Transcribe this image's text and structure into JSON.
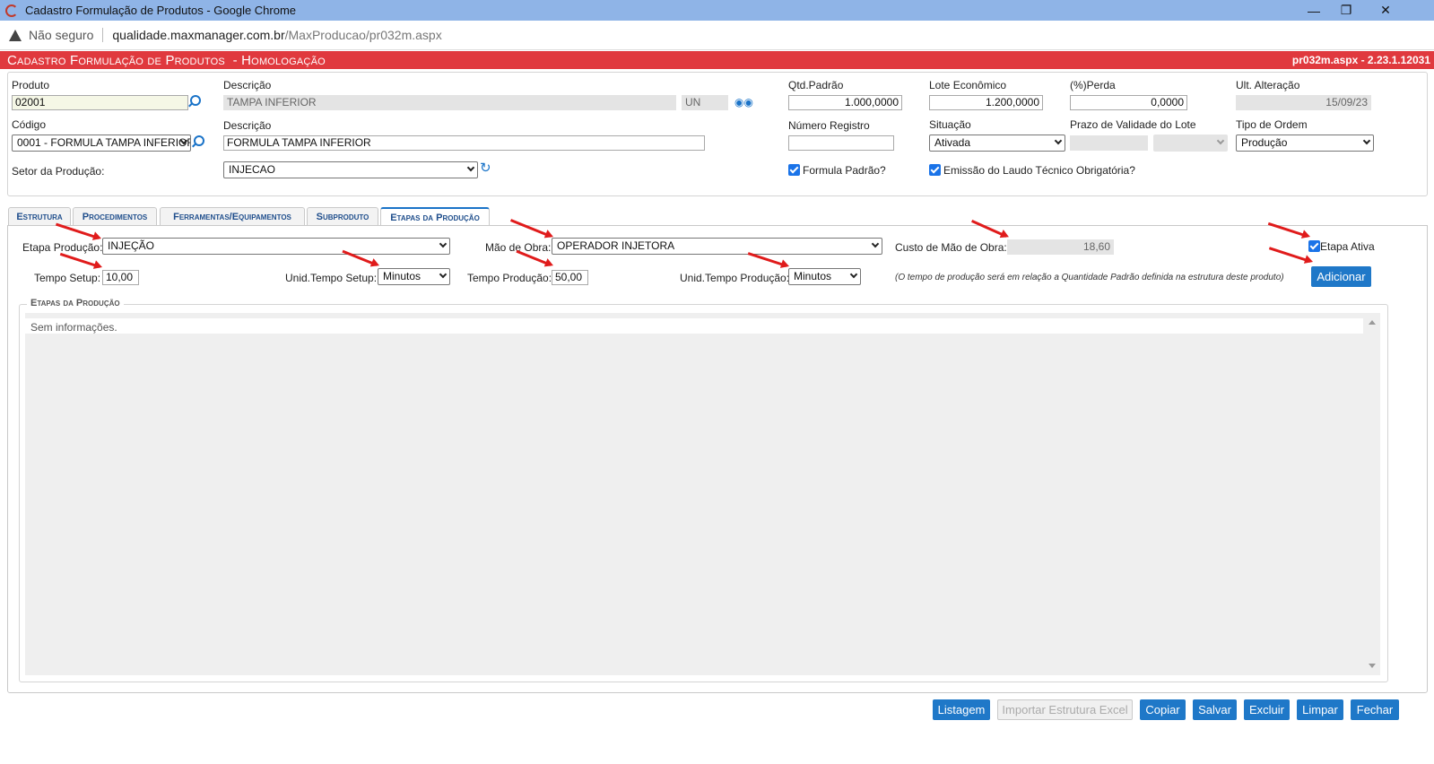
{
  "window": {
    "title": "Cadastro Formulação de Produtos - Google Chrome",
    "minimize": "—",
    "restore": "❐",
    "close": "✕"
  },
  "address": {
    "security": "Não seguro",
    "host": "qualidade.maxmanager.com.br",
    "path": "/MaxProducao/pr032m.aspx"
  },
  "header": {
    "title": "Cadastro Formulação de Produtos  - Homologação",
    "version": "pr032m.aspx - 2.23.1.12031"
  },
  "form": {
    "produto_label": "Produto",
    "produto_value": "02001",
    "descricao_label": "Descrição",
    "descricao_value": "TAMPA INFERIOR",
    "unidade_value": "UN",
    "qtd_padrao_label": "Qtd.Padrão",
    "qtd_padrao_value": "1.000,0000",
    "lote_economico_label": "Lote Econômico",
    "lote_economico_value": "1.200,0000",
    "perda_label": "(%)Perda",
    "perda_value": "0,0000",
    "ult_alteracao_label": "Ult. Alteração",
    "ult_alteracao_value": "15/09/23",
    "codigo_label": "Código",
    "codigo_value": "0001 - FORMULA TAMPA INFERIOR",
    "descricao2_label": "Descrição",
    "descricao2_value": "FORMULA TAMPA INFERIOR",
    "numero_registro_label": "Número Registro",
    "numero_registro_value": "",
    "situacao_label": "Situação",
    "situacao_value": "Ativada",
    "prazo_validade_label": "Prazo de Validade do Lote",
    "prazo_validade_value": "",
    "prazo_validade_unit": "",
    "tipo_ordem_label": "Tipo de Ordem",
    "tipo_ordem_value": "Produção",
    "setor_label": "Setor da Produção:",
    "setor_value": "INJECAO",
    "formula_padrao_label": "Formula Padrão?",
    "formula_padrao_checked": true,
    "emissao_laudo_label": "Emissão do Laudo Técnico Obrigatória?",
    "emissao_laudo_checked": true
  },
  "tabs": [
    {
      "label": "Estrutura",
      "active": false
    },
    {
      "label": "Procedimentos",
      "active": false
    },
    {
      "label": "Ferramentas/Equipamentos",
      "active": false
    },
    {
      "label": "Subproduto",
      "active": false
    },
    {
      "label": "Etapas da Produção",
      "active": true
    }
  ],
  "etapa": {
    "etapa_label": "Etapa Produção:",
    "etapa_value": "INJEÇÃO",
    "mao_obra_label": "Mão de Obra:",
    "mao_obra_value": "OPERADOR INJETORA",
    "custo_label": "Custo de Mão de Obra:",
    "custo_value": "18,60",
    "ativa_label": "Etapa Ativa",
    "ativa_checked": true,
    "tempo_setup_label": "Tempo Setup:",
    "tempo_setup_value": "10,00",
    "unid_setup_label": "Unid.Tempo Setup:",
    "unid_setup_value": "Minutos",
    "tempo_producao_label": "Tempo Produção:",
    "tempo_producao_value": "50,00",
    "unid_producao_label": "Unid.Tempo Produção:",
    "unid_producao_value": "Minutos",
    "note": "(O tempo de produção será em relação a Quantidade Padrão definida na estrutura deste produto)",
    "add_button": "Adicionar"
  },
  "grid": {
    "legend": "Etapas da Produção",
    "empty": "Sem informações."
  },
  "footer": {
    "listagem": "Listagem",
    "importar": "Importar Estrutura Excel",
    "copiar": "Copiar",
    "salvar": "Salvar",
    "excluir": "Excluir",
    "limpar": "Limpar",
    "fechar": "Fechar"
  },
  "colors": {
    "header_bg": "#e0393e",
    "accent": "#1f78c8",
    "annotation_arrow": "#e01b1b",
    "titlebar": "#8fb4e7"
  }
}
